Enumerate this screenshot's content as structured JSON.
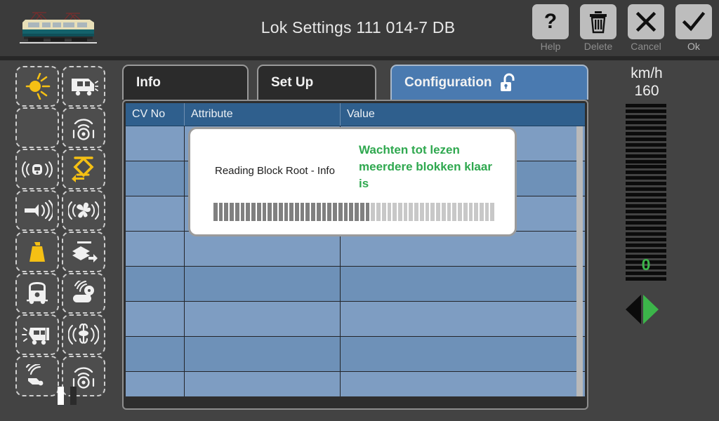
{
  "window": {
    "title": "Lok Settings 111 014-7 DB",
    "locomotive_icon": "electric-locomotive-image"
  },
  "toolbar": {
    "buttons": [
      {
        "label": "Help",
        "icon": "question-mark-icon"
      },
      {
        "label": "Delete",
        "icon": "trash-can-icon"
      },
      {
        "label": "Cancel",
        "icon": "close-x-icon"
      },
      {
        "label": "Ok",
        "icon": "checkmark-icon"
      }
    ]
  },
  "sidebar": {
    "items": [
      {
        "icon": "headlight-sun-icon",
        "active": true,
        "empty": false
      },
      {
        "icon": "train-cab-light-icon",
        "active": false,
        "empty": false
      },
      {
        "icon": "blank-icon",
        "active": false,
        "empty": true
      },
      {
        "icon": "radio-waves-speaker-icon",
        "active": false,
        "empty": false
      },
      {
        "icon": "train-horn-sound-icon",
        "active": false,
        "empty": false
      },
      {
        "icon": "pantograph-icon",
        "active": true,
        "empty": false
      },
      {
        "icon": "air-horn-icon",
        "active": false,
        "empty": false
      },
      {
        "icon": "fan-blower-sound-icon",
        "active": false,
        "empty": false
      },
      {
        "icon": "weight-load-icon",
        "active": true,
        "empty": false
      },
      {
        "icon": "coupler-shunting-icon",
        "active": false,
        "empty": false
      },
      {
        "icon": "train-front-icon",
        "active": false,
        "empty": false
      },
      {
        "icon": "whistle-signal-icon",
        "active": false,
        "empty": false
      },
      {
        "icon": "train-brake-squeal-icon",
        "active": false,
        "empty": false
      },
      {
        "icon": "steam-release-icon",
        "active": false,
        "empty": false
      },
      {
        "icon": "sound-waves-horn-icon",
        "active": false,
        "empty": false
      },
      {
        "icon": "radio-waves-speaker-2-icon",
        "active": false,
        "empty": false
      }
    ],
    "page_indicator": {
      "current_page": 1,
      "total_pages": 2
    }
  },
  "tabs": [
    {
      "label": "Info",
      "active": false,
      "icon": null
    },
    {
      "label": "Set Up",
      "active": false,
      "icon": null
    },
    {
      "label": "Configuration",
      "active": true,
      "icon": "unlocked-padlock-icon"
    }
  ],
  "table": {
    "columns": [
      "CV No",
      "Attribute",
      "Value"
    ],
    "rows": [
      {
        "cv_no": "",
        "attribute": "",
        "value": ""
      },
      {
        "cv_no": "",
        "attribute": "",
        "value": ""
      },
      {
        "cv_no": "",
        "attribute": "",
        "value": ""
      },
      {
        "cv_no": "",
        "attribute": "",
        "value": ""
      },
      {
        "cv_no": "",
        "attribute": "",
        "value": ""
      },
      {
        "cv_no": "",
        "attribute": "",
        "value": ""
      },
      {
        "cv_no": "",
        "attribute": "",
        "value": ""
      },
      {
        "cv_no": "",
        "attribute": "",
        "value": ""
      }
    ]
  },
  "dialog": {
    "label": "Reading Block Root - Info",
    "message": "Wachten tot lezen meerdere blokken klaar is",
    "progress_percent": 56,
    "progress_segments": 52
  },
  "speed_panel": {
    "unit": "km/h",
    "max_speed": "160",
    "current_speed": "0",
    "scale_segments": 32,
    "direction_backward_icon": "triangle-left-icon",
    "direction_forward_icon": "triangle-right-icon",
    "direction_selected": "forward"
  },
  "colors": {
    "background": "#434343",
    "titlebar": "#3b3b3b",
    "accent_blue": "#4a7ab0",
    "header_blue": "#2f5f8d",
    "row_blue_light": "#7e9dc2",
    "row_blue_dark": "#6e91b8",
    "status_green": "#2fa84f",
    "active_yellow": "#f5c014",
    "dialog_white": "#ffffff"
  }
}
